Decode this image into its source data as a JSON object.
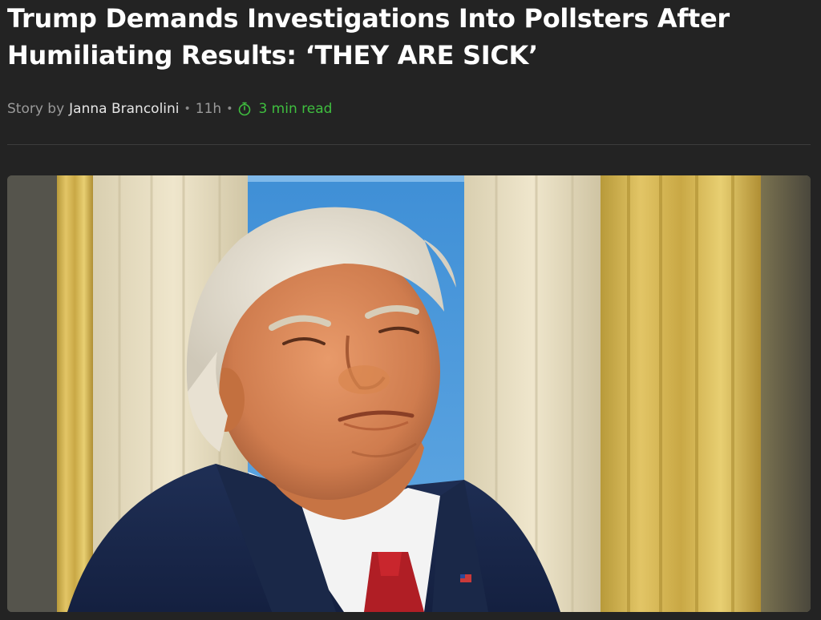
{
  "article": {
    "headline": "Trump Demands Investigations Into Pollsters After Humiliating Results: ‘THEY ARE SICK’",
    "byline": {
      "prefix": "Story by",
      "author": "Janna Brancolini",
      "separator": "•",
      "age": "11h",
      "read_time_icon": "timer-icon",
      "read_time": "3 min read"
    },
    "hero_image": {
      "subject": "man in navy suit with red tie squinting, grimacing with pursed lips, in front of gold drapes and a blue window"
    }
  },
  "colors": {
    "page_background": "#232323",
    "headline_text": "#ffffff",
    "meta_text": "#9a9a9a",
    "author_text": "#e6e6e6",
    "read_time_accent": "#3fbf3f"
  }
}
